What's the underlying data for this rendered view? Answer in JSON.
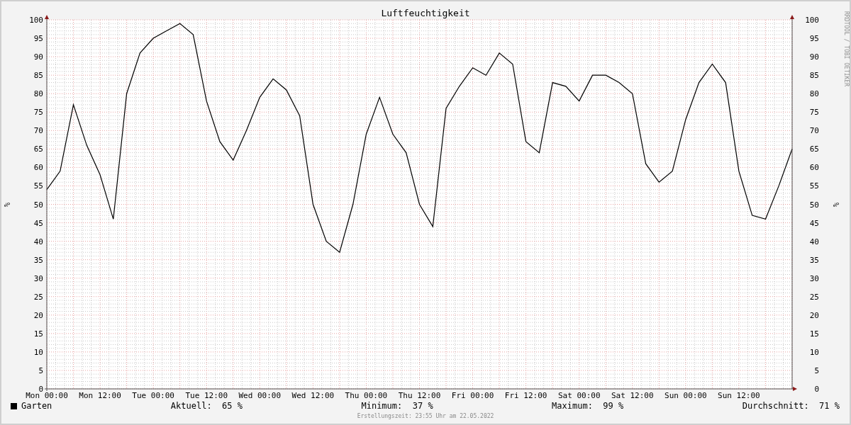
{
  "credit": "RRDTOOL / TOBI OETIKER",
  "chart_data": {
    "type": "line",
    "title": "Luftfeuchtigkeit",
    "ylabel": "%",
    "ylim": [
      0,
      100
    ],
    "grid": true,
    "categories": [
      "Mon 00:00",
      null,
      null,
      null,
      "Mon 12:00",
      null,
      null,
      null,
      "Tue 00:00",
      null,
      null,
      null,
      "Tue 12:00",
      null,
      null,
      null,
      "Wed 00:00",
      null,
      null,
      null,
      "Wed 12:00",
      null,
      null,
      null,
      "Thu 00:00",
      null,
      null,
      null,
      "Thu 12:00",
      null,
      null,
      null,
      "Fri 00:00",
      null,
      null,
      null,
      "Fri 12:00",
      null,
      null,
      null,
      "Sat 00:00",
      null,
      null,
      null,
      "Sat 12:00",
      null,
      null,
      null,
      "Sun 00:00",
      null,
      null,
      null,
      "Sun 12:00",
      null,
      null,
      null,
      null
    ],
    "yticks": [
      0,
      5,
      10,
      15,
      20,
      25,
      30,
      35,
      40,
      45,
      50,
      55,
      60,
      65,
      70,
      75,
      80,
      85,
      90,
      95,
      100
    ],
    "series": [
      {
        "name": "Garten",
        "color": "#000000",
        "values": [
          54,
          59,
          77,
          66,
          58,
          46,
          80,
          91,
          95,
          97,
          99,
          96,
          78,
          67,
          62,
          70,
          79,
          84,
          81,
          74,
          50,
          40,
          37,
          50,
          69,
          79,
          69,
          64,
          50,
          44,
          76,
          82,
          87,
          85,
          91,
          88,
          67,
          64,
          83,
          82,
          78,
          85,
          85,
          83,
          80,
          61,
          56,
          59,
          73,
          83,
          88,
          83,
          59,
          47,
          46,
          55,
          65
        ]
      }
    ]
  },
  "legend": {
    "stats": [
      {
        "label": "Aktuell:",
        "value": "65 %"
      },
      {
        "label": "Minimum:",
        "value": "37 %"
      },
      {
        "label": "Maximum:",
        "value": "99 %"
      },
      {
        "label": "Durchschnitt:",
        "value": "71 %"
      }
    ]
  },
  "right_axis": {
    "label": "%",
    "ticks": [
      "100",
      "95",
      "90",
      "85",
      "80",
      "75",
      "70",
      "65",
      "60",
      "55",
      "50",
      "45",
      "40",
      "35",
      "30",
      "25",
      "20",
      "15",
      "10",
      "5",
      "0"
    ]
  },
  "footer": "Erstellungszeit: 23:55 Uhr am 22.05.2022"
}
